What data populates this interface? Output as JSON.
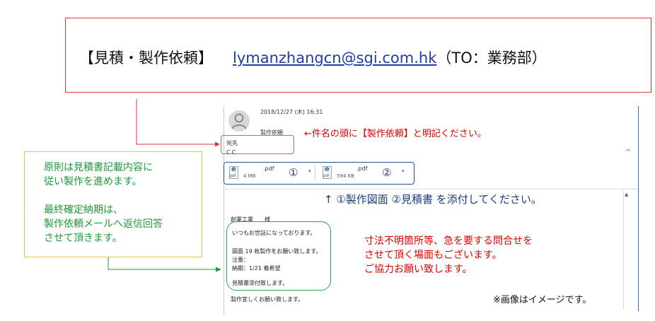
{
  "banner": {
    "title": "【見積・製作依頼】",
    "email": "lymanzhangcn@sgi.com.hk",
    "recipient": "（TO：業務部）"
  },
  "mail": {
    "date": "2018/12/27 (木) 16:31",
    "subject": "製作依頼",
    "subject_note": "←件名の頭に【製作依頼】と明記ください。",
    "to_label": "宛先",
    "cc_label": "CC",
    "attachments": [
      {
        "name": ".pdf",
        "size": "4 MB",
        "marker": "①",
        "icon_label": "pdf"
      },
      {
        "name": ".pdf",
        "size": "594 KB",
        "marker": "②",
        "icon_label": "pdf"
      }
    ],
    "attachment_note": "↑ ①製作図面 ②見積書 を添付してください。",
    "greeting": "創業工業　　様",
    "body_lines": [
      "いつもお世話になっております。",
      "",
      "図面 19 枚製作をお願い致します。",
      "注番：",
      "納期：1/21 着希望",
      "",
      "見積書添付致します。"
    ],
    "closing": "製作宜しくお願い致します。"
  },
  "red_note": [
    "寸法不明箇所等、急を要する問合せを",
    "させて頂く場面もございます。",
    "ご協力お願い致します。"
  ],
  "callout": [
    "原則は見積書記載内容に",
    "従い製作を進めます。",
    "",
    "最終確定納期は、",
    "製作依頼メールへ返信回答",
    "させて頂きます。"
  ],
  "footnote": "※画像はイメージです。",
  "colors": {
    "red": "#e00000",
    "green": "#1e9a3a",
    "navy": "#1b3d7a",
    "callout_border": "#f2c24a",
    "link": "#1f3fa8"
  },
  "icons": [
    "person-avatar-icon",
    "pdf-file-icon",
    "chevron-down-icon",
    "chevron-up-icon"
  ]
}
